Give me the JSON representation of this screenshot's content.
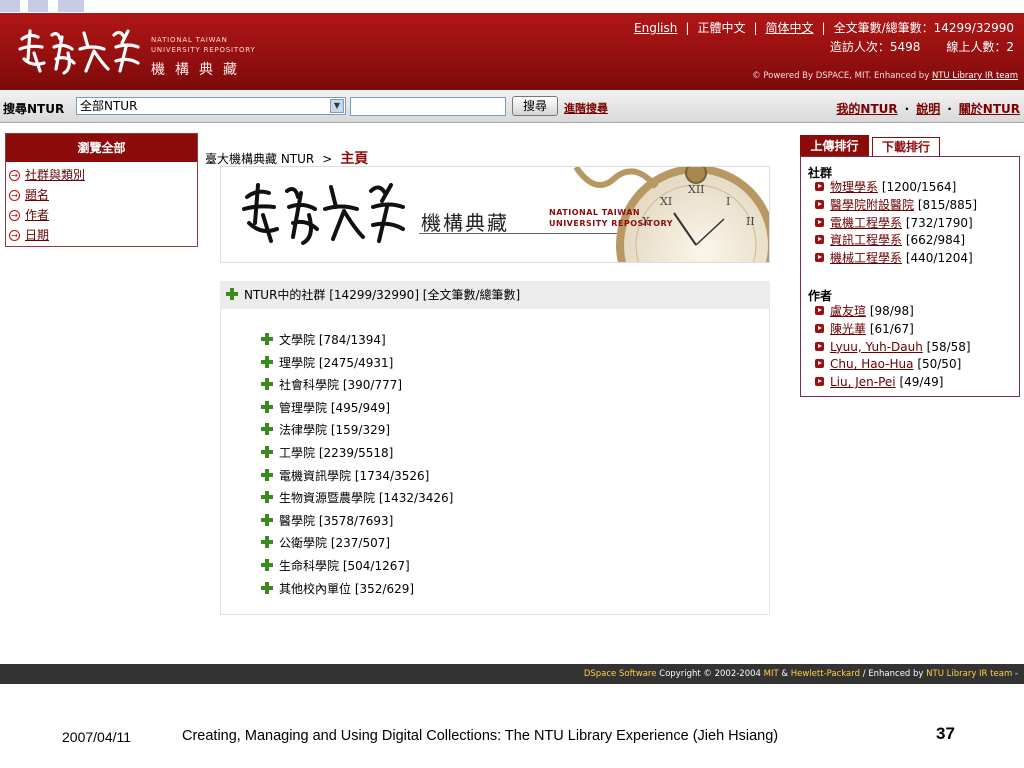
{
  "header": {
    "logo_script": "臺灣大學",
    "logo_en_line1": "NATIONAL TAIWAN",
    "logo_en_line2": "UNIVERSITY REPOSITORY",
    "logo_zh": "機構典藏",
    "languages": [
      "English",
      "正體中文",
      "简体中文"
    ],
    "fulltext_stat": "全文筆數/總筆數：14299/32990",
    "visits_stat": "造訪人次：5498",
    "online_stat": "線上人數：2",
    "powered_prefix": "© Powered By DSPACE, MIT. Enhanced by",
    "powered_link": "NTU Library IR team"
  },
  "search": {
    "label": "搜尋NTUR",
    "scope_value": "全部NTUR",
    "button": "搜尋",
    "advanced": "進階搜尋",
    "links": [
      "我的NTUR",
      "說明",
      "關於NTUR"
    ]
  },
  "browse": {
    "title": "瀏覽全部",
    "items": [
      "社群與類別",
      "題名",
      "作者",
      "日期"
    ]
  },
  "breadcrumb": {
    "root": "臺大機構典藏 NTUR",
    "separator": ">",
    "current": "主頁"
  },
  "banner": {
    "script": "臺灣大學",
    "zh": "機構典藏",
    "en_line1": "NATIONAL TAIWAN",
    "en_line2": "UNIVERSITY REPOSITORY"
  },
  "communities": {
    "header": "NTUR中的社群 [14299/32990] [全文筆數/總筆數]",
    "items": [
      "文學院 [784/1394]",
      "理學院 [2475/4931]",
      "社會科學院 [390/777]",
      "管理學院 [495/949]",
      "法律學院 [159/329]",
      "工學院 [2239/5518]",
      "電機資訊學院 [1734/3526]",
      "生物資源暨農學院 [1432/3426]",
      "醫學院 [3578/7693]",
      "公衛學院 [237/507]",
      "生命科學院 [504/1267]",
      "其他校內單位 [352/629]"
    ]
  },
  "ranking": {
    "tab_active": "上傳排行",
    "tab_inactive": "下載排行",
    "community_heading": "社群",
    "communities": [
      {
        "name": "物理學系",
        "count": "[1200/1564]"
      },
      {
        "name": "醫學院附設醫院",
        "count": "[815/885]"
      },
      {
        "name": "電機工程學系",
        "count": "[732/1790]"
      },
      {
        "name": "資訊工程學系",
        "count": "[662/984]"
      },
      {
        "name": "機械工程學系",
        "count": "[440/1204]"
      }
    ],
    "author_heading": "作者",
    "authors": [
      {
        "name": "盧友瑄",
        "count": "[98/98]"
      },
      {
        "name": "陳光華",
        "count": "[61/67]"
      },
      {
        "name": "Lyuu, Yuh-Dauh",
        "count": "[58/58]"
      },
      {
        "name": "Chu, Hao-Hua",
        "count": "[50/50]"
      },
      {
        "name": "Liu, Jen-Pei",
        "count": "[49/49]"
      }
    ]
  },
  "footer": {
    "dspace": "DSpace Software",
    "copyright": "Copyright © 2002-2004",
    "mit": "MIT",
    "amp": "&",
    "hp": "Hewlett-Packard",
    "sep": "/",
    "enhanced": "Enhanced by",
    "team": "NTU Library IR team",
    "dash": "-"
  },
  "slide": {
    "date": "2007/04/11",
    "title": "Creating, Managing and Using Digital Collections: The NTU Library Experience (Jieh Hsiang)",
    "page_number": "37"
  },
  "colors": {
    "header_red": "#961010",
    "accent_dark_red": "#8c0b0b",
    "link_red": "#6a0000",
    "plus_green": "#3c8a1e"
  }
}
